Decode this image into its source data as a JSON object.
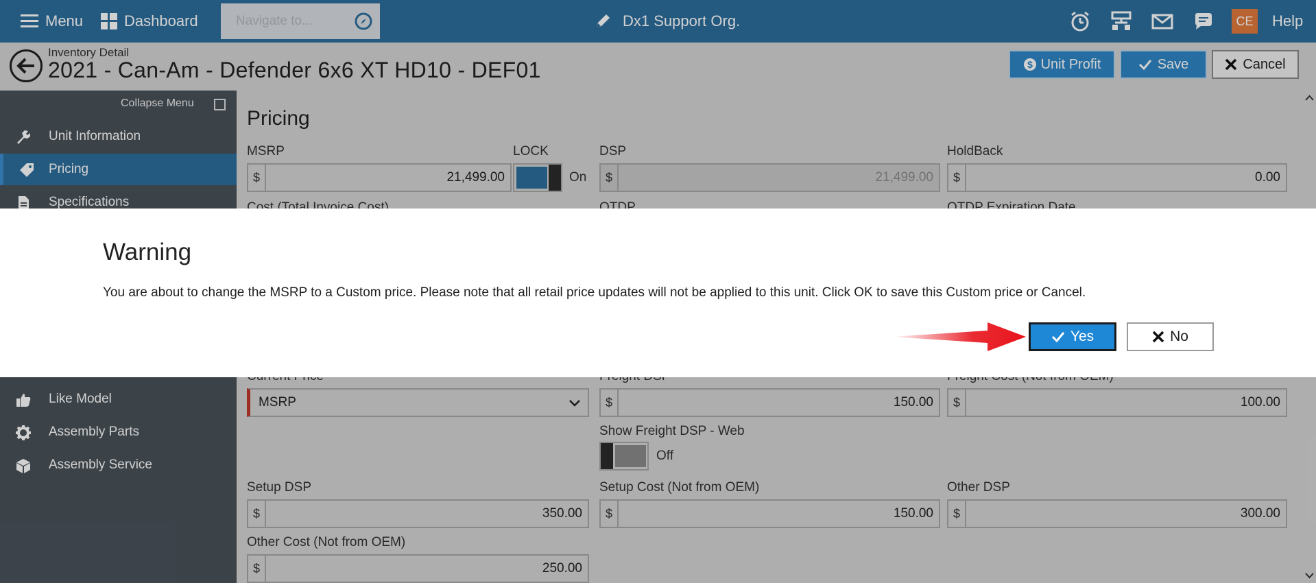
{
  "topbar": {
    "menu_label": "Menu",
    "dashboard_label": "Dashboard",
    "navigate_placeholder": "Navigate to...",
    "org_name": "Dx1 Support Org.",
    "avatar_initials": "CE",
    "help_label": "Help",
    "icons": [
      "hamburger-icon",
      "dashboard-grid-icon",
      "compass-icon",
      "pencil-icon",
      "alarm-clock-icon",
      "sitemap-icon",
      "mail-icon",
      "chat-icon"
    ]
  },
  "header": {
    "breadcrumb": "Inventory Detail",
    "title": "2021 - Can-Am - Defender 6x6 XT HD10 - DEF01",
    "unit_profit_label": "Unit Profit",
    "save_label": "Save",
    "cancel_label": "Cancel"
  },
  "sidebar": {
    "collapse_label": "Collapse Menu",
    "items": [
      {
        "label": "Unit Information",
        "icon": "wrench-icon",
        "active": false
      },
      {
        "label": "Pricing",
        "icon": "tag-icon",
        "active": true
      },
      {
        "label": "Specifications",
        "icon": "document-icon",
        "active": false
      },
      {
        "label": "Like Model",
        "icon": "thumbs-up-icon",
        "active": false
      },
      {
        "label": "Assembly Parts",
        "icon": "gear-icon",
        "active": false
      },
      {
        "label": "Assembly Service",
        "icon": "box-icon",
        "active": false
      }
    ]
  },
  "pricing": {
    "section_title": "Pricing",
    "currency": "$",
    "msrp": {
      "label": "MSRP",
      "value": "21,499.00"
    },
    "lock": {
      "label": "LOCK",
      "state": "On"
    },
    "dsp": {
      "label": "DSP",
      "value": "21,499.00"
    },
    "holdback": {
      "label": "HoldBack",
      "value": "0.00"
    },
    "cost_label": "Cost (Total Invoice Cost)",
    "otdp_label": "OTDP",
    "otdp_exp_label": "OTDP Expiration Date",
    "current_price": {
      "label": "Current Price",
      "value": "MSRP"
    },
    "freight_dsp": {
      "label": "Freight DSP",
      "value": "150.00"
    },
    "freight_cost": {
      "label": "Freight Cost (Not from OEM)",
      "value": "100.00"
    },
    "show_freight": {
      "label": "Show Freight DSP - Web",
      "state": "Off"
    },
    "setup_dsp": {
      "label": "Setup DSP",
      "value": "350.00"
    },
    "setup_cost": {
      "label": "Setup Cost (Not from OEM)",
      "value": "150.00"
    },
    "other_dsp": {
      "label": "Other DSP",
      "value": "300.00"
    },
    "other_cost": {
      "label": "Other Cost (Not from OEM)",
      "value": "250.00"
    }
  },
  "modal": {
    "title": "Warning",
    "message": "You are about to change the MSRP to a Custom price. Please note that all retail price updates will not be applied to this unit. Click OK to save this Custom price or Cancel.",
    "yes_label": "Yes",
    "no_label": "No"
  },
  "colors": {
    "topbar": "#2d6e9d",
    "sidebar": "#49525a",
    "primary_button": "#2f86c6",
    "yes_button": "#1f88d6",
    "arrow": "#e8141c",
    "avatar": "#e07b3d"
  }
}
